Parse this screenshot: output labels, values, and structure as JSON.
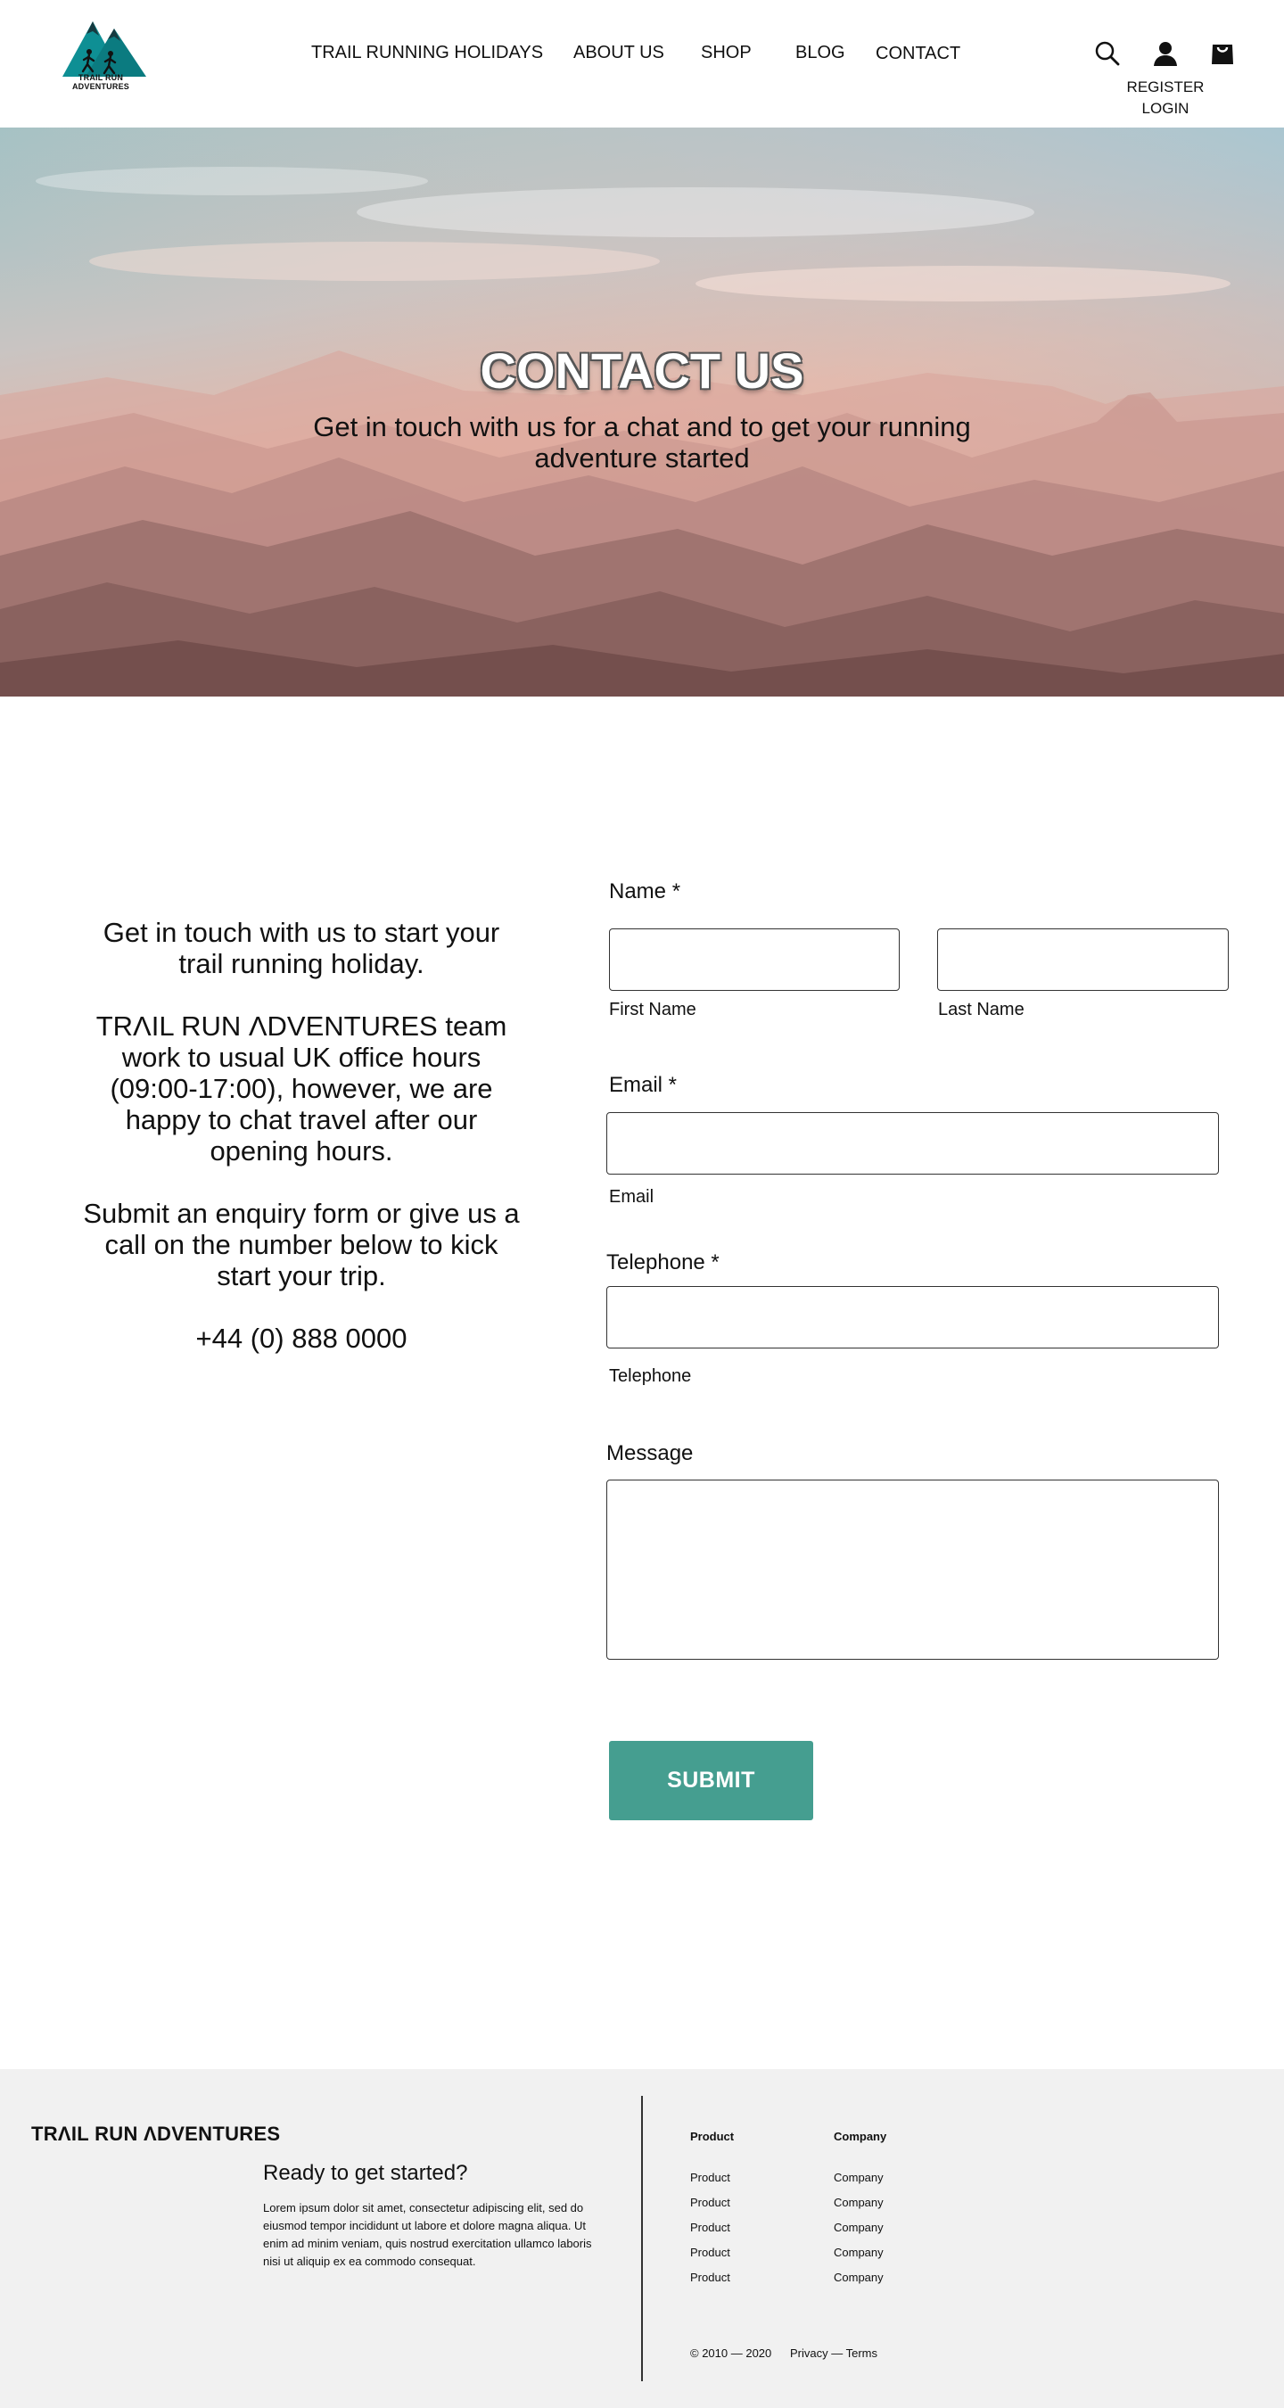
{
  "brand": {
    "logo_text": "TRAIL RUN ADVENTURES",
    "footer_name": "TRΛIL RUN ΛDVENTURES"
  },
  "nav": {
    "items": [
      "TRAIL RUNNING HOLIDAYS",
      "ABOUT US",
      "SHOP",
      "BLOG",
      "CONTACT"
    ]
  },
  "header": {
    "icons": [
      "search-icon",
      "user-icon",
      "shopping-bag-icon"
    ],
    "register_label": "REGISTER",
    "login_label": "LOGIN"
  },
  "hero": {
    "title": "CONTACT US",
    "subtitle": "Get in touch with us for a chat and to get your running adventure started"
  },
  "intro": {
    "p1": "Get in touch with us to start your trail running holiday.",
    "p2": "TRΛIL RUN ΛDVENTURES team work to usual UK office hours (09:00-17:00), however, we are happy to chat travel after our opening hours.",
    "p3": "Submit an enquiry form or give us a call on the number below to kick start your trip.",
    "phone": "+44 (0) 888 0000"
  },
  "form": {
    "name_label": "Name *",
    "first_name_sub": "First Name",
    "last_name_sub": "Last Name",
    "first_name_value": "",
    "last_name_value": "",
    "email_label": "Email *",
    "email_sub": "Email",
    "email_value": "",
    "telephone_label": "Telephone *",
    "telephone_sub": "Telephone",
    "telephone_value": "",
    "message_label": "Message",
    "message_value": "",
    "submit_label": "SUBMIT",
    "accent_color": "#459e90"
  },
  "footer": {
    "heading": "Ready to get started?",
    "body": "Lorem ipsum dolor sit amet, consectetur adipiscing elit, sed do eiusmod tempor incididunt ut labore et dolore magna aliqua. Ut enim ad minim veniam, quis nostrud exercitation ullamco laboris nisi ut aliquip ex ea commodo consequat.",
    "columns": [
      {
        "title": "Product",
        "items": [
          "Product",
          "Product",
          "Product",
          "Product",
          "Product"
        ]
      },
      {
        "title": "Company",
        "items": [
          "Company",
          "Company",
          "Company",
          "Company",
          "Company"
        ]
      }
    ],
    "copyright": "© 2010 — 2020",
    "legal": "Privacy — Terms"
  }
}
